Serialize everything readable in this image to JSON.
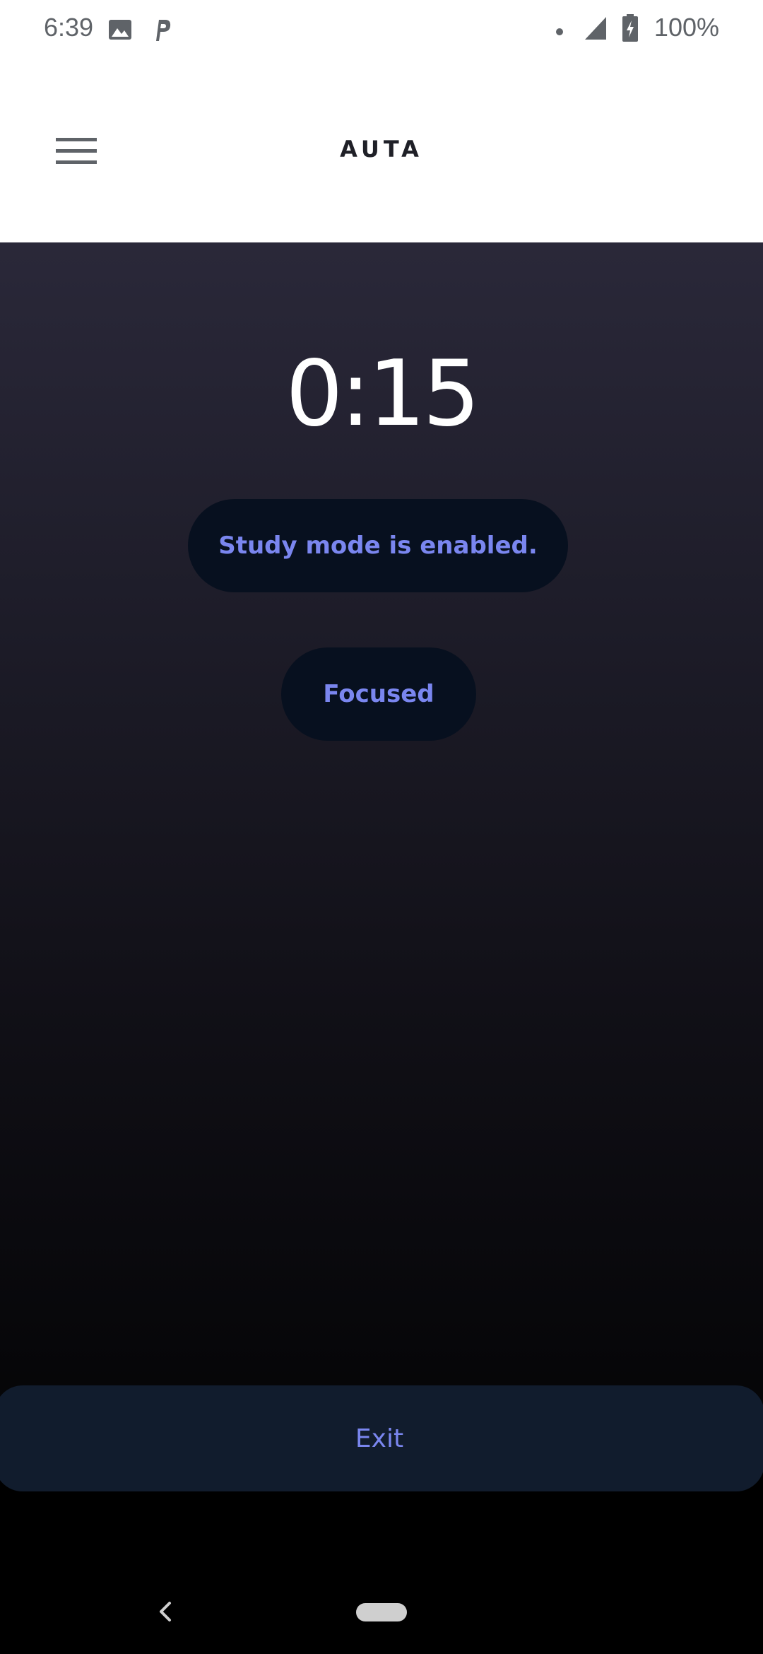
{
  "status_bar": {
    "time": "6:39",
    "battery_percent": "100%",
    "icons": [
      "image-notification-icon",
      "parking-notification-icon",
      "dot-icon",
      "signal-icon",
      "battery-charging-icon"
    ]
  },
  "app_bar": {
    "title": "AUTA",
    "menu_icon": "hamburger-menu-icon"
  },
  "main": {
    "timer": "0:15",
    "status_pill": "Study mode is enabled.",
    "mode_pill": "Focused",
    "exit_label": "Exit"
  },
  "colors": {
    "accent": "#7a86ef",
    "pill_background": "#07101f",
    "exit_background": "#111c2d",
    "gradient_top": "#2a2839",
    "gradient_bottom": "#050507"
  },
  "nav_bar": {
    "icons": [
      "back-icon",
      "home-pill-icon"
    ]
  }
}
